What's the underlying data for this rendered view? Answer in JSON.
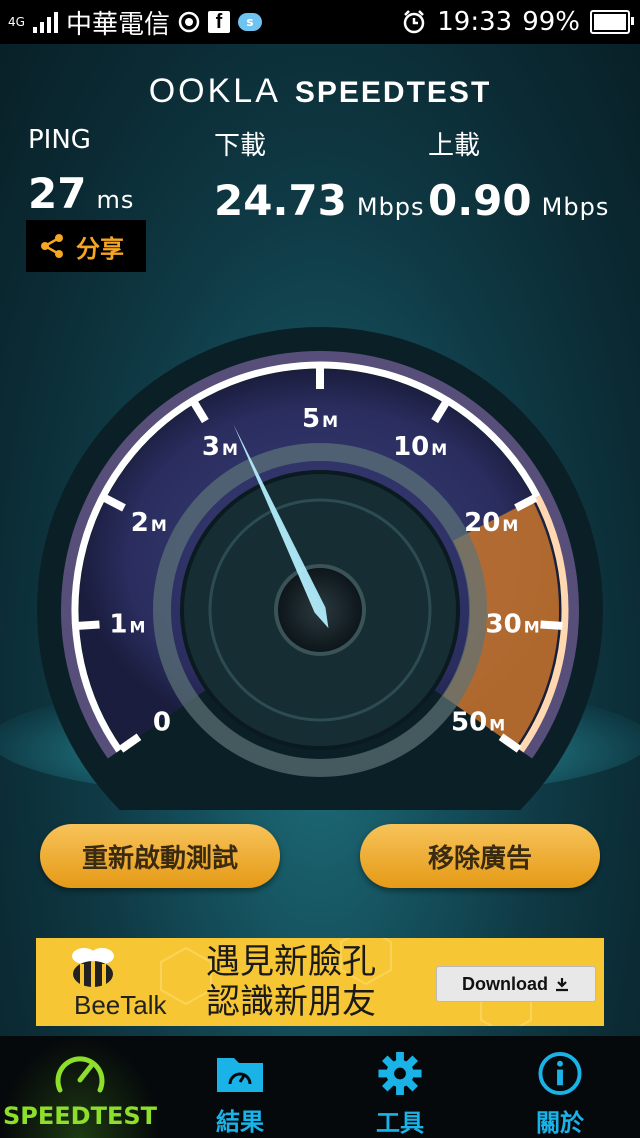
{
  "status_bar": {
    "network_type": "4G",
    "carrier": "中華電信",
    "time": "19:33",
    "battery": "99%",
    "battery_level": 0.99
  },
  "header": {
    "brand": "OOKLA",
    "product": "SPEEDTEST"
  },
  "metrics": {
    "ping": {
      "label": "PING",
      "value": "27",
      "unit": "ms"
    },
    "download": {
      "label": "下載",
      "value": "24.73",
      "unit": "Mbps"
    },
    "upload": {
      "label": "上載",
      "value": "0.90",
      "unit": "Mbps"
    }
  },
  "share_label": "分享",
  "gauge": {
    "ticks": [
      {
        "label": "0",
        "unit": ""
      },
      {
        "label": "1",
        "unit": "M"
      },
      {
        "label": "2",
        "unit": "M"
      },
      {
        "label": "3",
        "unit": "M"
      },
      {
        "label": "5",
        "unit": "M"
      },
      {
        "label": "10",
        "unit": "M"
      },
      {
        "label": "20",
        "unit": "M"
      },
      {
        "label": "30",
        "unit": "M"
      },
      {
        "label": "50",
        "unit": "M"
      }
    ],
    "needle_tick_position": 0.4,
    "highlight_from_tick": 6
  },
  "buttons": {
    "restart": "重新啟動測試",
    "remove_ads": "移除廣告"
  },
  "ad": {
    "line1": "遇見新臉孔",
    "line2": "認識新朋友",
    "brand": "BeeTalk",
    "download": "Download"
  },
  "nav": [
    {
      "label": "SPEEDTEST",
      "icon": "speedometer-icon",
      "active": true
    },
    {
      "label": "結果",
      "icon": "folder-icon",
      "active": false
    },
    {
      "label": "工具",
      "icon": "gear-icon",
      "active": false
    },
    {
      "label": "關於",
      "icon": "info-icon",
      "active": false
    }
  ],
  "colors": {
    "accent_green": "#8ddf2c",
    "accent_blue": "#1ab3e8",
    "gold": "#f0ad2a",
    "arc_purple": "#b48ae0",
    "arc_orange": "#f08a2a"
  }
}
